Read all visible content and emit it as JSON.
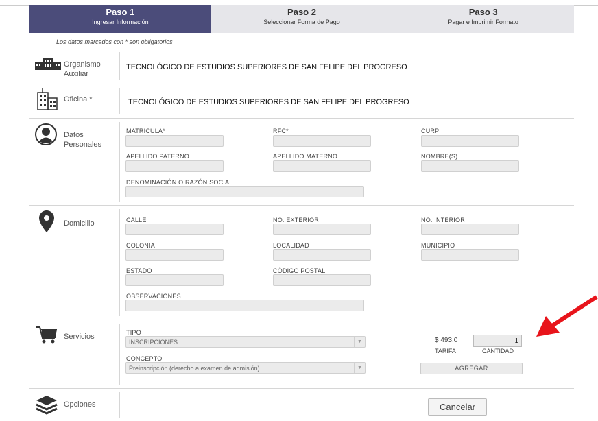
{
  "steps": [
    {
      "title": "Paso 1",
      "subtitle": "Ingresar Información"
    },
    {
      "title": "Paso 2",
      "subtitle": "Seleccionar Forma de Pago"
    },
    {
      "title": "Paso 3",
      "subtitle": "Pagar e Imprimir Formato"
    }
  ],
  "note": "Los datos marcados con * son obligatorios",
  "sections": {
    "organismo": {
      "label": "Organismo Auxiliar",
      "value": "TECNOLÓGICO DE ESTUDIOS SUPERIORES DE SAN FELIPE DEL PROGRESO",
      "icon": "building-icon"
    },
    "oficina": {
      "label": "Oficina *",
      "value": "TECNOLÓGICO DE ESTUDIOS SUPERIORES DE SAN FELIPE DEL PROGRESO",
      "icon": "office-icon"
    },
    "personales": {
      "label": "Datos Personales",
      "icon": "user-icon",
      "fields": [
        "MATRICULA*",
        "RFC*",
        "CURP",
        "APELLIDO PATERNO",
        "APELLIDO MATERNO",
        "NOMBRE(S)",
        "DENOMINACIÓN O RAZÓN SOCIAL"
      ]
    },
    "domicilio": {
      "label": "Domicilio",
      "icon": "location-pin-icon",
      "fields": [
        "CALLE",
        "NO. EXTERIOR",
        "NO. INTERIOR",
        "COLONIA",
        "LOCALIDAD",
        "MUNICIPIO",
        "ESTADO",
        "CÓDIGO POSTAL",
        "OBSERVACIONES"
      ]
    },
    "servicios": {
      "label": "Servicios",
      "icon": "cart-icon",
      "tipo_label": "TIPO",
      "tipo_value": "INSCRIPCIONES",
      "concepto_label": "CONCEPTO",
      "concepto_value": "Preinscripción (derecho a examen de admisión)",
      "tarifa_value": "$ 493.0",
      "tarifa_label": "TARIFA",
      "cantidad_value": "1",
      "cantidad_label": "CANTIDAD",
      "add_label": "AGREGAR"
    },
    "opciones": {
      "label": "Opciones",
      "icon": "layers-icon",
      "cancel_label": "Cancelar"
    }
  },
  "colors": {
    "active_step": "#4b4c7a",
    "inactive_step": "#e6e6ea",
    "arrow": "#e8141b"
  }
}
